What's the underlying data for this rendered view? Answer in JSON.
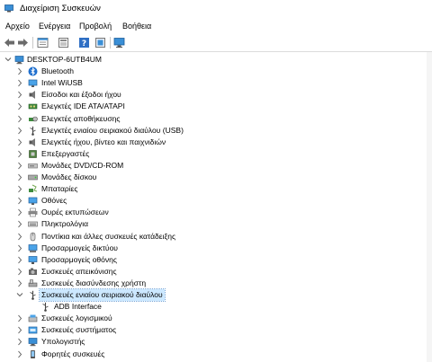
{
  "window": {
    "title": "Διαχείριση Συσκευών"
  },
  "menu": [
    {
      "id": "file",
      "label": "Αρχείο"
    },
    {
      "id": "action",
      "label": "Ενέργεια"
    },
    {
      "id": "view",
      "label": "Προβολή"
    },
    {
      "id": "help",
      "label": "Βοήθεια"
    }
  ],
  "tree": {
    "root": "DESKTOP-6UTB4UM",
    "categories": [
      {
        "label": "Bluetooth",
        "icon": "bluetooth-icon"
      },
      {
        "label": "Intel WiUSB",
        "icon": "monitor-icon"
      },
      {
        "label": "Είσοδοι και έξοδοι ήχου",
        "icon": "speaker-icon"
      },
      {
        "label": "Ελεγκτές IDE ATA/ATAPI",
        "icon": "ide-controller-icon"
      },
      {
        "label": "Ελεγκτές αποθήκευσης",
        "icon": "storage-controller-icon"
      },
      {
        "label": "Ελεγκτές ενιαίου σειριακού διαύλου (USB)",
        "icon": "usb-icon"
      },
      {
        "label": "Ελεγκτές ήχου, βίντεο και παιχνιδιών",
        "icon": "speaker-icon"
      },
      {
        "label": "Επεξεργαστές",
        "icon": "processor-icon"
      },
      {
        "label": "Μονάδες DVD/CD-ROM",
        "icon": "dvd-drive-icon"
      },
      {
        "label": "Μονάδες δίσκου",
        "icon": "disk-drive-icon"
      },
      {
        "label": "Μπαταρίες",
        "icon": "battery-icon"
      },
      {
        "label": "Οθόνες",
        "icon": "monitor-icon"
      },
      {
        "label": "Ουρές εκτυπώσεων",
        "icon": "printer-icon"
      },
      {
        "label": "Πληκτρολόγια",
        "icon": "keyboard-icon"
      },
      {
        "label": "Ποντίκια και άλλες συσκευές κατάδειξης",
        "icon": "mouse-icon"
      },
      {
        "label": "Προσαρμογείς δικτύου",
        "icon": "network-adapter-icon"
      },
      {
        "label": "Προσαρμογείς οθόνης",
        "icon": "display-adapter-icon"
      },
      {
        "label": "Συσκευές απεικόνισης",
        "icon": "camera-icon"
      },
      {
        "label": "Συσκευές διασύνδεσης χρήστη",
        "icon": "hid-icon"
      },
      {
        "label": "Συσκευές ενιαίου σειριακού διαύλου",
        "icon": "usb-icon",
        "expanded": true,
        "selected": true,
        "children": [
          {
            "label": "ADB Interface",
            "icon": "usb-icon"
          }
        ]
      },
      {
        "label": "Συσκευές λογισμικού",
        "icon": "software-device-icon"
      },
      {
        "label": "Συσκευές συστήματος",
        "icon": "system-device-icon"
      },
      {
        "label": "Υπολογιστής",
        "icon": "computer-icon"
      },
      {
        "label": "Φορητές συσκευές",
        "icon": "portable-device-icon"
      }
    ]
  }
}
